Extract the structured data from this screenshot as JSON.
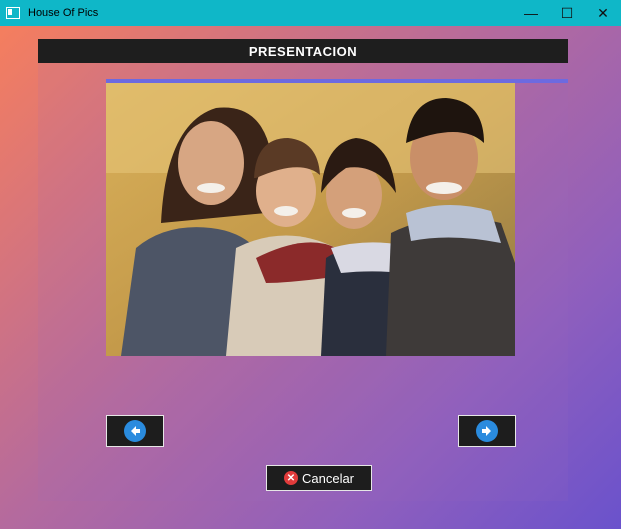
{
  "window": {
    "title": "House Of Pics",
    "controls": {
      "minimize": "—",
      "maximize": "☐",
      "close": "✕"
    }
  },
  "header": {
    "title": "PRESENTACION"
  },
  "photo": {
    "description_icon": "family-photo"
  },
  "navigation": {
    "prev_icon": "arrow-left-icon",
    "next_icon": "arrow-right-icon"
  },
  "cancel": {
    "label": "Cancelar",
    "icon": "close-circle-icon"
  },
  "colors": {
    "titlebar": "#0fb7c8",
    "accent": "#6d6ae0",
    "button_bg": "#1d1d1d",
    "arrow": "#2a8bde",
    "cancel_icon": "#e23b3b"
  }
}
